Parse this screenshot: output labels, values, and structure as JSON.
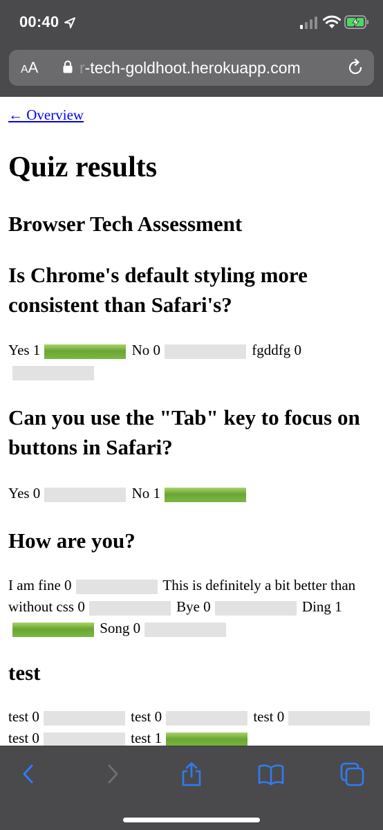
{
  "status": {
    "time": "00:40"
  },
  "browser": {
    "aa_large": "A",
    "aa_small": "A",
    "url_faded": "r",
    "url": "-tech-goldhoot.herokuapp.com"
  },
  "page": {
    "back_link": "← Overview",
    "title": "Quiz results",
    "subtitle": "Browser Tech Assessment",
    "questions": [
      {
        "text": "Is Chrome's default styling more consistent than Safari's?",
        "answers": [
          {
            "label": "Yes 1",
            "fraction": 1
          },
          {
            "label": "No 0",
            "fraction": 0
          },
          {
            "label": "fgddfg 0",
            "fraction": 0
          }
        ]
      },
      {
        "text": "Can you use the \"Tab\" key to focus on buttons in Safari?",
        "answers": [
          {
            "label": "Yes 0",
            "fraction": 0
          },
          {
            "label": "No 1",
            "fraction": 1
          }
        ]
      },
      {
        "text": "How are you?",
        "answers": [
          {
            "label": "I am fine 0",
            "fraction": 0
          },
          {
            "label": "This is definitely a bit better than without css 0",
            "fraction": 0
          },
          {
            "label": "Bye 0",
            "fraction": 0
          },
          {
            "label": "Ding 1",
            "fraction": 1
          },
          {
            "label": "Song 0",
            "fraction": 0
          }
        ]
      },
      {
        "text": "test",
        "answers": [
          {
            "label": "test 0",
            "fraction": 0
          },
          {
            "label": "test 0",
            "fraction": 0
          },
          {
            "label": "test 0",
            "fraction": 0
          },
          {
            "label": "test 0",
            "fraction": 0
          },
          {
            "label": "test 1",
            "fraction": 1
          }
        ]
      }
    ]
  },
  "colors": {
    "chrome": "#4a4a4c",
    "link": "#0000ee",
    "bar_empty": "#e2e2e2",
    "bar_fill": "#7cb642",
    "toolbar_icon": "#2f7cf6"
  },
  "toolbar": {
    "icons": [
      "back-icon",
      "forward-icon",
      "share-icon",
      "bookmarks-icon",
      "tabs-icon"
    ]
  }
}
